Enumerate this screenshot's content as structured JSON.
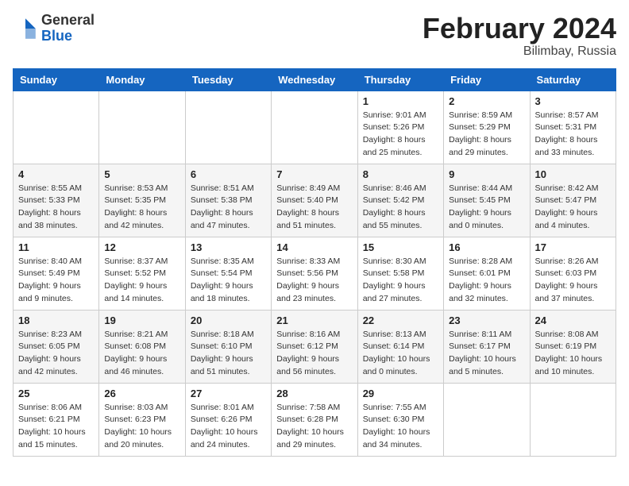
{
  "logo": {
    "general": "General",
    "blue": "Blue"
  },
  "header": {
    "month_year": "February 2024",
    "location": "Bilimbay, Russia"
  },
  "weekdays": [
    "Sunday",
    "Monday",
    "Tuesday",
    "Wednesday",
    "Thursday",
    "Friday",
    "Saturday"
  ],
  "weeks": [
    [
      {
        "day": "",
        "info": ""
      },
      {
        "day": "",
        "info": ""
      },
      {
        "day": "",
        "info": ""
      },
      {
        "day": "",
        "info": ""
      },
      {
        "day": "1",
        "info": "Sunrise: 9:01 AM\nSunset: 5:26 PM\nDaylight: 8 hours\nand 25 minutes."
      },
      {
        "day": "2",
        "info": "Sunrise: 8:59 AM\nSunset: 5:29 PM\nDaylight: 8 hours\nand 29 minutes."
      },
      {
        "day": "3",
        "info": "Sunrise: 8:57 AM\nSunset: 5:31 PM\nDaylight: 8 hours\nand 33 minutes."
      }
    ],
    [
      {
        "day": "4",
        "info": "Sunrise: 8:55 AM\nSunset: 5:33 PM\nDaylight: 8 hours\nand 38 minutes."
      },
      {
        "day": "5",
        "info": "Sunrise: 8:53 AM\nSunset: 5:35 PM\nDaylight: 8 hours\nand 42 minutes."
      },
      {
        "day": "6",
        "info": "Sunrise: 8:51 AM\nSunset: 5:38 PM\nDaylight: 8 hours\nand 47 minutes."
      },
      {
        "day": "7",
        "info": "Sunrise: 8:49 AM\nSunset: 5:40 PM\nDaylight: 8 hours\nand 51 minutes."
      },
      {
        "day": "8",
        "info": "Sunrise: 8:46 AM\nSunset: 5:42 PM\nDaylight: 8 hours\nand 55 minutes."
      },
      {
        "day": "9",
        "info": "Sunrise: 8:44 AM\nSunset: 5:45 PM\nDaylight: 9 hours\nand 0 minutes."
      },
      {
        "day": "10",
        "info": "Sunrise: 8:42 AM\nSunset: 5:47 PM\nDaylight: 9 hours\nand 4 minutes."
      }
    ],
    [
      {
        "day": "11",
        "info": "Sunrise: 8:40 AM\nSunset: 5:49 PM\nDaylight: 9 hours\nand 9 minutes."
      },
      {
        "day": "12",
        "info": "Sunrise: 8:37 AM\nSunset: 5:52 PM\nDaylight: 9 hours\nand 14 minutes."
      },
      {
        "day": "13",
        "info": "Sunrise: 8:35 AM\nSunset: 5:54 PM\nDaylight: 9 hours\nand 18 minutes."
      },
      {
        "day": "14",
        "info": "Sunrise: 8:33 AM\nSunset: 5:56 PM\nDaylight: 9 hours\nand 23 minutes."
      },
      {
        "day": "15",
        "info": "Sunrise: 8:30 AM\nSunset: 5:58 PM\nDaylight: 9 hours\nand 27 minutes."
      },
      {
        "day": "16",
        "info": "Sunrise: 8:28 AM\nSunset: 6:01 PM\nDaylight: 9 hours\nand 32 minutes."
      },
      {
        "day": "17",
        "info": "Sunrise: 8:26 AM\nSunset: 6:03 PM\nDaylight: 9 hours\nand 37 minutes."
      }
    ],
    [
      {
        "day": "18",
        "info": "Sunrise: 8:23 AM\nSunset: 6:05 PM\nDaylight: 9 hours\nand 42 minutes."
      },
      {
        "day": "19",
        "info": "Sunrise: 8:21 AM\nSunset: 6:08 PM\nDaylight: 9 hours\nand 46 minutes."
      },
      {
        "day": "20",
        "info": "Sunrise: 8:18 AM\nSunset: 6:10 PM\nDaylight: 9 hours\nand 51 minutes."
      },
      {
        "day": "21",
        "info": "Sunrise: 8:16 AM\nSunset: 6:12 PM\nDaylight: 9 hours\nand 56 minutes."
      },
      {
        "day": "22",
        "info": "Sunrise: 8:13 AM\nSunset: 6:14 PM\nDaylight: 10 hours\nand 0 minutes."
      },
      {
        "day": "23",
        "info": "Sunrise: 8:11 AM\nSunset: 6:17 PM\nDaylight: 10 hours\nand 5 minutes."
      },
      {
        "day": "24",
        "info": "Sunrise: 8:08 AM\nSunset: 6:19 PM\nDaylight: 10 hours\nand 10 minutes."
      }
    ],
    [
      {
        "day": "25",
        "info": "Sunrise: 8:06 AM\nSunset: 6:21 PM\nDaylight: 10 hours\nand 15 minutes."
      },
      {
        "day": "26",
        "info": "Sunrise: 8:03 AM\nSunset: 6:23 PM\nDaylight: 10 hours\nand 20 minutes."
      },
      {
        "day": "27",
        "info": "Sunrise: 8:01 AM\nSunset: 6:26 PM\nDaylight: 10 hours\nand 24 minutes."
      },
      {
        "day": "28",
        "info": "Sunrise: 7:58 AM\nSunset: 6:28 PM\nDaylight: 10 hours\nand 29 minutes."
      },
      {
        "day": "29",
        "info": "Sunrise: 7:55 AM\nSunset: 6:30 PM\nDaylight: 10 hours\nand 34 minutes."
      },
      {
        "day": "",
        "info": ""
      },
      {
        "day": "",
        "info": ""
      }
    ]
  ]
}
